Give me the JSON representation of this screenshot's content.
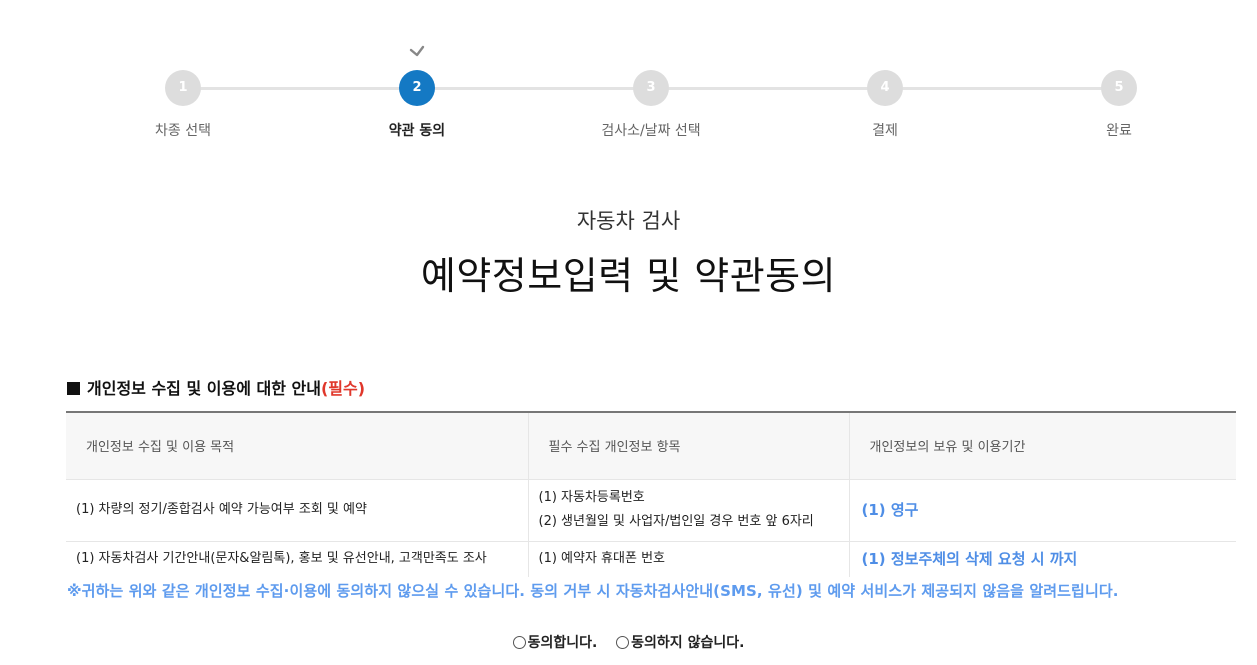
{
  "stepper": {
    "steps": [
      {
        "number": "1",
        "label": "차종 선택"
      },
      {
        "number": "2",
        "label": "약관 동의"
      },
      {
        "number": "3",
        "label": "검사소/날짜 선택"
      },
      {
        "number": "4",
        "label": "결제"
      },
      {
        "number": "5",
        "label": "완료"
      }
    ],
    "active_step": "2",
    "active_color": "#1479c4"
  },
  "header": {
    "sub_title": "자동차 검사",
    "main_title": "예약정보입력 및 약관동의"
  },
  "section": {
    "heading": "개인정보 수집 및 이용에 대한 안내",
    "required_label": "(필수)",
    "required_color": "#e0372b"
  },
  "table": {
    "headers": [
      "개인정보 수집 및 이용 목적",
      "필수 수집 개인정보 항목",
      "개인정보의 보유 및 이용기간"
    ],
    "rows": [
      {
        "purpose": "(1) 차량의 정기/종합검사 예약 가능여부 조회 및 예약",
        "items": [
          "(1) 자동차등록번호",
          "(2) 생년월일 및 사업자/법인일 경우 번호 앞 6자리"
        ],
        "period": "(1) 영구"
      },
      {
        "purpose": "(1) 자동차검사 기간안내(문자&알림톡), 홍보 및 유선안내, 고객만족도 조사",
        "items": [
          "(1) 예약자 휴대폰 번호"
        ],
        "period": "(1) 정보주체의 삭제 요청 시 까지"
      }
    ]
  },
  "notice": "※귀하는 위와 같은 개인정보 수집·이용에 동의하지 않으실 수 있습니다. 동의 거부 시 자동차검사안내(SMS, 유선) 및 예약 서비스가 제공되지 않음을 알려드립니다.",
  "consent": {
    "agree_label": "동의합니다.",
    "disagree_label": "동의하지 않습니다."
  },
  "icons": {
    "current_step_marker": "check-icon"
  }
}
